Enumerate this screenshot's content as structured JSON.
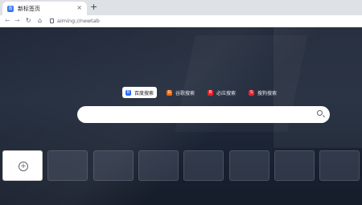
{
  "browser": {
    "tab": {
      "title": "新标签页",
      "favicon": "B"
    },
    "close_glyph": "×",
    "new_tab_glyph": "+",
    "nav": {
      "back": "←",
      "forward": "→",
      "reload": "↻",
      "home": "⌂"
    },
    "url": "aiming://newtab"
  },
  "page": {
    "search_engines": [
      {
        "label": "百度搜索",
        "icon_letter": "B",
        "icon_color": "#2f6bff",
        "active": true
      },
      {
        "label": "谷歌搜索",
        "icon_letter": "G",
        "icon_color": "#ff6a00",
        "active": false
      },
      {
        "label": "必应搜索",
        "icon_letter": "B",
        "icon_color": "#e8242b",
        "active": false
      },
      {
        "label": "搜狗搜索",
        "icon_letter": "S",
        "icon_color": "#e8242b",
        "active": false
      }
    ],
    "search_placeholder": "",
    "add_tile_glyph": "+",
    "tiles_count_visible": 8
  }
}
